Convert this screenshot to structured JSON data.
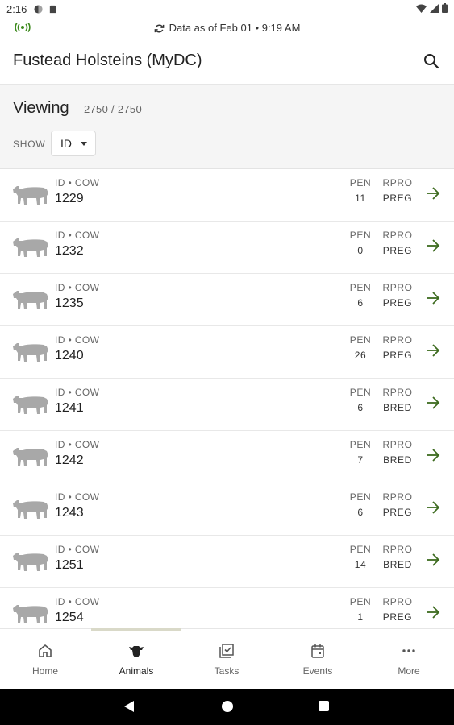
{
  "status_bar": {
    "time": "2:16"
  },
  "sync": {
    "text": "Data as of Feb 01 • 9:19 AM"
  },
  "app_bar": {
    "title": "Fustead Holsteins (MyDC)"
  },
  "viewing": {
    "label": "Viewing",
    "count": "2750 / 2750",
    "show_label": "SHOW",
    "show_value": "ID"
  },
  "columns": {
    "pen": "PEN",
    "rpro": "RPRO"
  },
  "animals": [
    {
      "sub": "ID • COW",
      "id": "1229",
      "pen": "11",
      "rpro": "PREG"
    },
    {
      "sub": "ID • COW",
      "id": "1232",
      "pen": "0",
      "rpro": "PREG"
    },
    {
      "sub": "ID • COW",
      "id": "1235",
      "pen": "6",
      "rpro": "PREG"
    },
    {
      "sub": "ID • COW",
      "id": "1240",
      "pen": "26",
      "rpro": "PREG"
    },
    {
      "sub": "ID • COW",
      "id": "1241",
      "pen": "6",
      "rpro": "BRED"
    },
    {
      "sub": "ID • COW",
      "id": "1242",
      "pen": "7",
      "rpro": "BRED"
    },
    {
      "sub": "ID • COW",
      "id": "1243",
      "pen": "6",
      "rpro": "PREG"
    },
    {
      "sub": "ID • COW",
      "id": "1251",
      "pen": "14",
      "rpro": "BRED"
    },
    {
      "sub": "ID • COW",
      "id": "1254",
      "pen": "1",
      "rpro": "PREG"
    }
  ],
  "nav": {
    "items": [
      {
        "label": "Home",
        "icon": "home-icon"
      },
      {
        "label": "Animals",
        "icon": "cow-head-icon",
        "active": true
      },
      {
        "label": "Tasks",
        "icon": "tasks-icon"
      },
      {
        "label": "Events",
        "icon": "calendar-icon"
      },
      {
        "label": "More",
        "icon": "more-icon"
      }
    ]
  },
  "colors": {
    "accent_green": "#3d6b1f",
    "cow_gray": "#a8a8a8",
    "panel_bg": "#f5f5f5"
  }
}
